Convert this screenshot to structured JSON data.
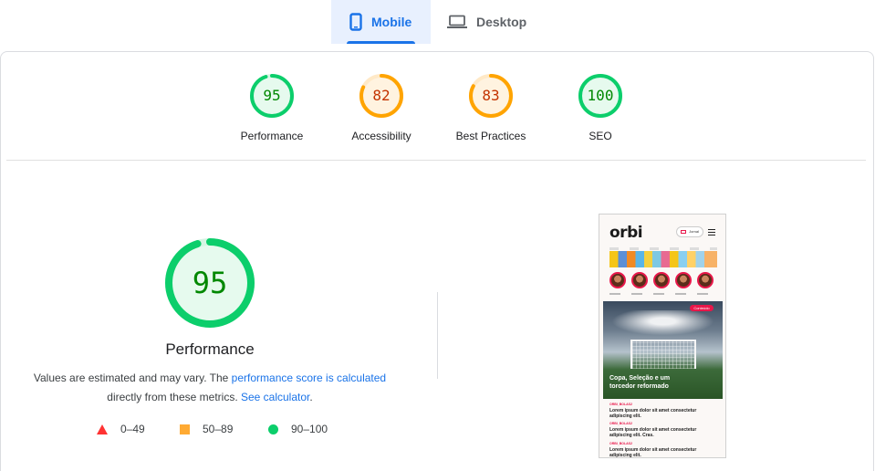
{
  "tabs": {
    "mobile_label": "Mobile",
    "desktop_label": "Desktop",
    "active": "mobile"
  },
  "categories": [
    {
      "key": "performance",
      "score": "95",
      "label": "Performance",
      "rating": "green"
    },
    {
      "key": "accessibility",
      "score": "82",
      "label": "Accessibility",
      "rating": "orange"
    },
    {
      "key": "best_practices",
      "score": "83",
      "label": "Best Practices",
      "rating": "orange"
    },
    {
      "key": "seo",
      "score": "100",
      "label": "SEO",
      "rating": "green"
    }
  ],
  "main": {
    "score": "95",
    "title": "Performance",
    "desc_prefix": "Values are estimated and may vary. The ",
    "desc_link1": "performance score is calculated",
    "desc_middle": "directly from these metrics. ",
    "desc_link2": "See calculator",
    "desc_suffix": "."
  },
  "legend": {
    "fail": "0–49",
    "average": "50–89",
    "pass": "90–100"
  },
  "colors": {
    "accent": "#1a73e8",
    "pass": "#0cce6b",
    "average": "#ffa400",
    "fail": "#ff3333"
  },
  "screenshot": {
    "logo": "orbi",
    "button": "Jornal",
    "tag": "Conteúdo",
    "headline": "Copa, Seleção e um torcedor reformado",
    "news": [
      {
        "category": "ORBI_BOLAS2",
        "title": "Lorem ipsum dolor sit amet consectetur adipiscing elit."
      },
      {
        "category": "ORBI_BOLAS2",
        "title": "Lorem ipsum dolor sit amet consectetur adipiscing elit. Cras."
      },
      {
        "category": "ORBI_BOLAS2",
        "title": "Lorem ipsum dolor sit amet consectetur adipiscing elit."
      }
    ]
  }
}
